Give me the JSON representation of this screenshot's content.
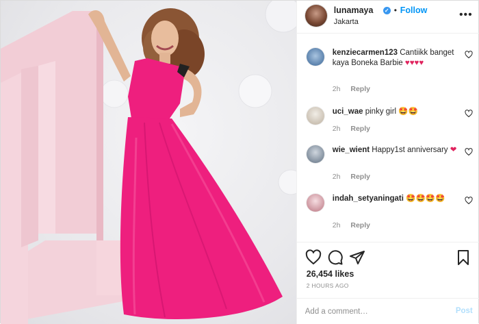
{
  "header": {
    "username": "lunamaya",
    "follow_label": "Follow",
    "separator": "•",
    "location": "Jakarta",
    "more_label": "•••"
  },
  "comments": [
    {
      "username": "kenziecarmen123",
      "text": "Cantiikk banget kaya Boneka Barbie ♥♥♥♥",
      "time": "2h",
      "reply_label": "Reply",
      "avatar_color": "#7aa0c8"
    },
    {
      "username": "uci_wae",
      "text": "pinky girl 🤩🤩",
      "time": "2h",
      "reply_label": "Reply",
      "avatar_color": "#d8d2c8"
    },
    {
      "username": "wie_wient",
      "text": "Happy1st anniversary ❤",
      "time": "2h",
      "reply_label": "Reply",
      "avatar_color": "#9aa7b5"
    },
    {
      "username": "indah_setyaningati",
      "text": "🤩🤩🤩🤩",
      "time": "2h",
      "reply_label": "Reply",
      "avatar_color": "#e7c6cc"
    }
  ],
  "actions": {
    "like_icon": "heart-icon",
    "comment_icon": "comment-icon",
    "share_icon": "share-icon",
    "save_icon": "bookmark-icon"
  },
  "likes_text": "26,454 likes",
  "time_text": "2 HOURS AGO",
  "add_comment": {
    "placeholder": "Add a comment…",
    "post_label": "Post"
  },
  "colors": {
    "accent": "#0095f6",
    "dress": "#ee1f7e",
    "post_disabled": "#b2dffc",
    "heart": "#e0245e"
  }
}
